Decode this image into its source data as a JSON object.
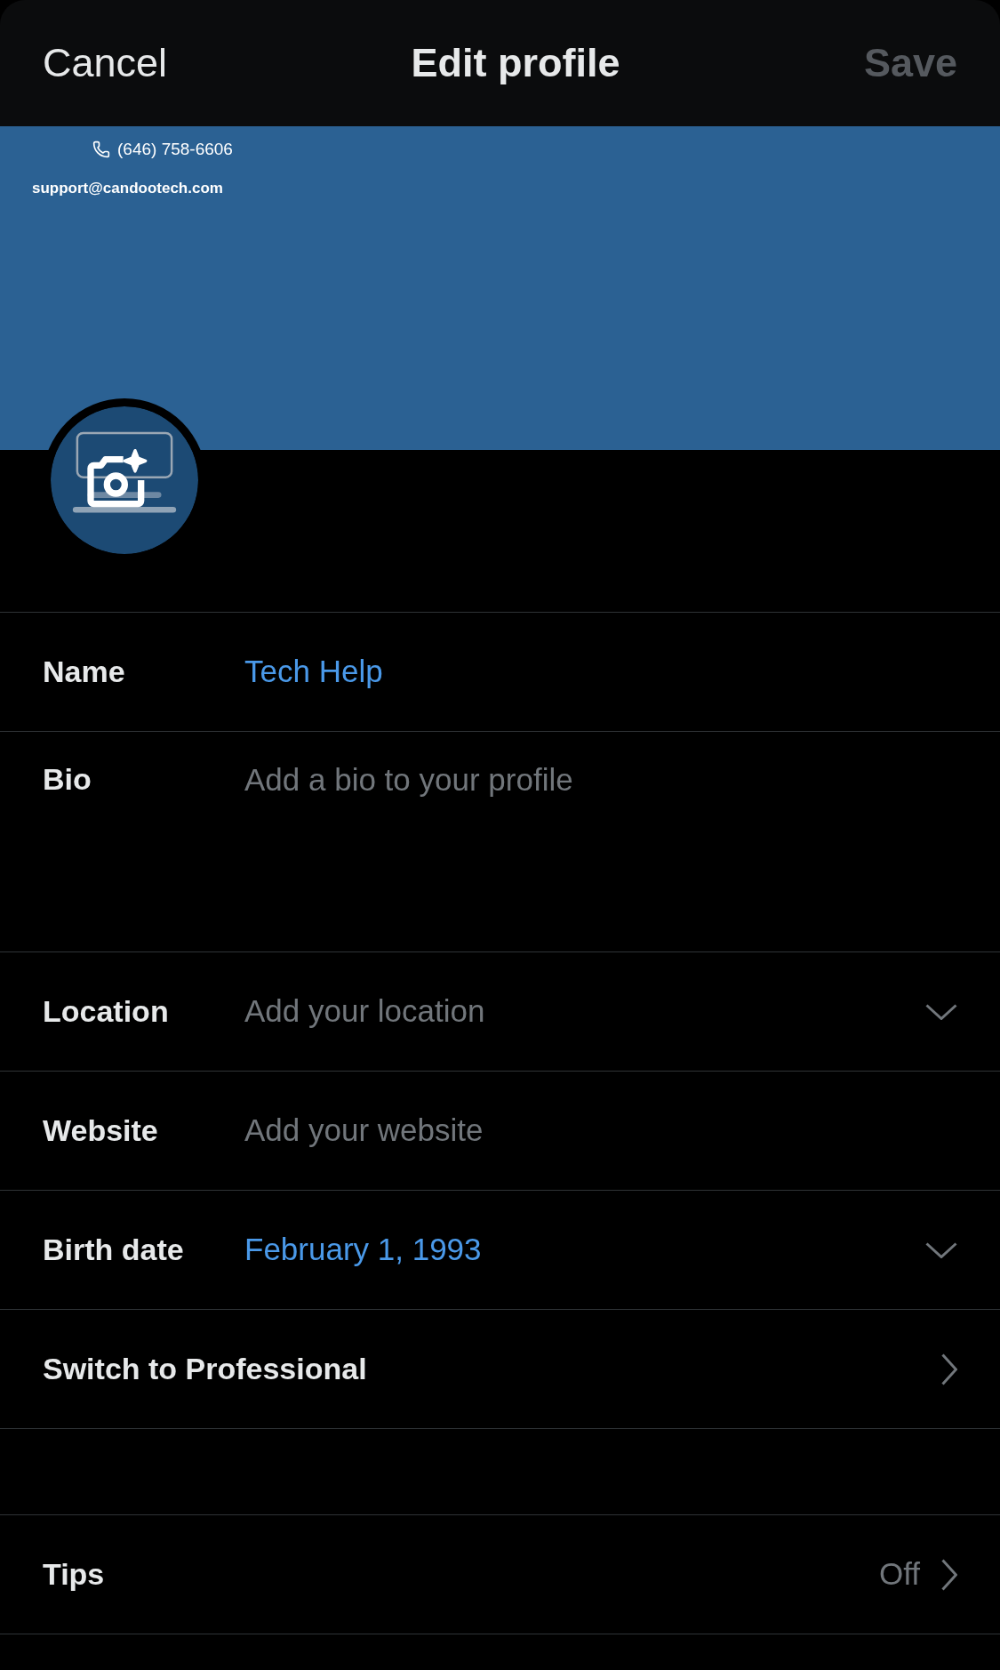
{
  "header": {
    "cancel": "Cancel",
    "title": "Edit profile",
    "save": {
      "label": "Save",
      "disabled": true
    }
  },
  "banner": {
    "phone": "(646) 758-6606",
    "email": "support@candootech.com"
  },
  "fields": [
    {
      "label": "Name",
      "value": "Tech Help",
      "kind": "text"
    },
    {
      "label": "Bio",
      "placeholder": "Add a bio to your profile",
      "kind": "multiline"
    },
    {
      "label": "Location",
      "placeholder": "Add your location",
      "kind": "dropdown"
    },
    {
      "label": "Website",
      "placeholder": "Add your website",
      "kind": "text"
    },
    {
      "label": "Birth date",
      "value": "February 1, 1993",
      "kind": "dropdown"
    }
  ],
  "links": [
    {
      "label": "Switch to Professional"
    }
  ],
  "extra_links": [
    {
      "label": "Tips",
      "value": "Off"
    }
  ]
}
